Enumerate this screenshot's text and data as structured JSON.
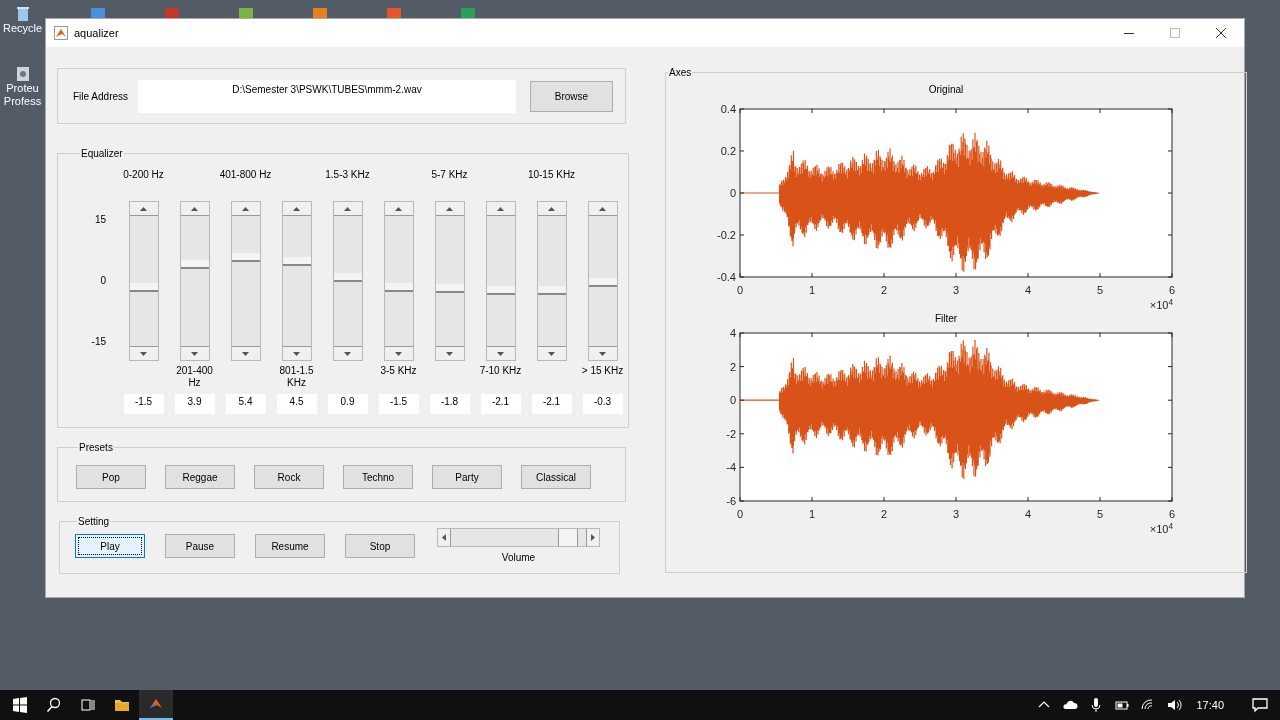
{
  "desktop": {
    "icons": [
      {
        "label": "Recycle"
      },
      {
        "label": "Proteu\nProfess"
      }
    ]
  },
  "window": {
    "title": "aqualizer"
  },
  "file_panel": {
    "label": "File Address",
    "value": "D:\\Semester 3\\PSWK\\TUBES\\mmm-2.wav",
    "button": "Browse"
  },
  "equalizer": {
    "title": "Equalizer",
    "scale": [
      "15",
      "0",
      "-15"
    ],
    "bands": [
      {
        "label": "0-200 Hz",
        "kind": "top",
        "level": 0.45,
        "value": "-1.5"
      },
      {
        "label": "201-400 Hz",
        "kind": "bottom",
        "level": 0.63,
        "value": "3.9"
      },
      {
        "label": "401-800 Hz",
        "kind": "top",
        "level": 0.68,
        "value": "5.4"
      },
      {
        "label": "801-1.5 KHz",
        "kind": "bottom",
        "level": 0.65,
        "value": "4.5"
      },
      {
        "label": "1.5-3 KHz",
        "kind": "top",
        "level": 0.53,
        "value": "0.9"
      },
      {
        "label": "3-5 KHz",
        "kind": "bottom",
        "level": 0.45,
        "value": "-1.5"
      },
      {
        "label": "5-7 KHz",
        "kind": "top",
        "level": 0.44,
        "value": "-1.8"
      },
      {
        "label": "7-10 KHz",
        "kind": "bottom",
        "level": 0.43,
        "value": "-2.1"
      },
      {
        "label": "10-15 KHz",
        "kind": "top",
        "level": 0.43,
        "value": "-2.1"
      },
      {
        "label": "> 15 KHz",
        "kind": "bottom",
        "level": 0.49,
        "value": "-0.3"
      }
    ]
  },
  "presets": {
    "title": "Presets",
    "buttons": [
      "Pop",
      "Reggae",
      "Rock",
      "Techno",
      "Party",
      "Classical"
    ]
  },
  "setting": {
    "title": "Setting",
    "buttons": [
      {
        "label": "Play",
        "focused": true
      },
      {
        "label": "Pause",
        "focused": false
      },
      {
        "label": "Resume",
        "focused": false
      },
      {
        "label": "Stop",
        "focused": false
      }
    ],
    "volume": {
      "label": "Volume",
      "level": 0.87
    }
  },
  "axes": {
    "title": "Axes",
    "plots": [
      {
        "title": "Original",
        "yticks": [
          "0.4",
          "0.2",
          "0",
          "-0.2",
          "-0.4"
        ],
        "xticks": [
          "0",
          "1",
          "2",
          "3",
          "4",
          "5",
          "6"
        ],
        "exponent": "×10$^{4}$"
      },
      {
        "title": "Filter",
        "yticks": [
          "4",
          "2",
          "0",
          "-2",
          "-4",
          "-6"
        ],
        "xticks": [
          "0",
          "1",
          "2",
          "3",
          "4",
          "5",
          "6"
        ],
        "exponent": "×10$^{4}$"
      }
    ]
  },
  "taskbar": {
    "time": "17:40"
  }
}
